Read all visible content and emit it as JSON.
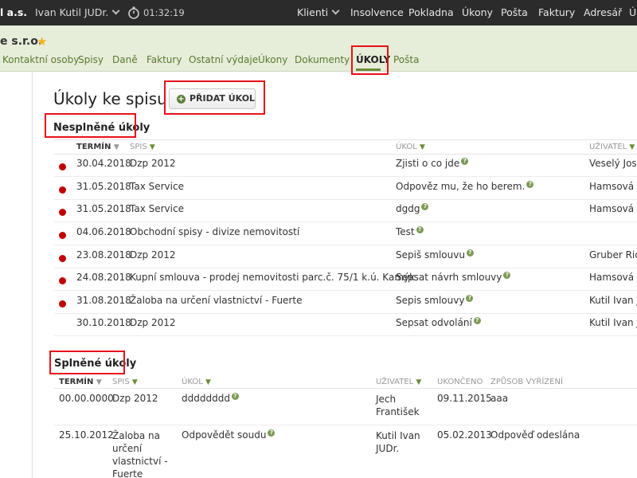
{
  "topbar": {
    "company": "l a.s.",
    "user": "Ivan Kutil JUDr.",
    "timer": "01:32:19",
    "nav": [
      "Klienti",
      "Insolvence",
      "Pokladna",
      "Úkony",
      "Pošta",
      "Faktury",
      "Adresář",
      "Ú"
    ]
  },
  "client": {
    "name": "e s.r.o.",
    "tabs": [
      "Kontaktní osoby",
      "Spisy",
      "Daně",
      "Faktury",
      "Ostatní výdaje",
      "Úkony",
      "Dokumenty",
      "ÚKOLY",
      "Pošta"
    ],
    "active_tab": "ÚKOLY"
  },
  "main": {
    "title": "Úkoly ke spisu",
    "add_button": "PŘIDAT ÚKOL"
  },
  "unfinished": {
    "title": "Nesplněné úkoly",
    "columns": [
      "TERMÍN",
      "SPIS",
      "ÚKOL",
      "UŽIVATEL"
    ],
    "rows": [
      {
        "overdue": true,
        "date": "30.04.2018",
        "file": "Dzp 2012",
        "task": "Zjisti o co jde",
        "user": "Veselý Josef"
      },
      {
        "overdue": true,
        "date": "31.05.2018",
        "file": "Tax Service",
        "task": "Odpověz mu, že ho berem.",
        "user": "Hamsová Te"
      },
      {
        "overdue": true,
        "date": "31.05.2018",
        "file": "Tax Service",
        "task": "dgdg",
        "user": "Hamsová Te"
      },
      {
        "overdue": true,
        "date": "04.06.2018",
        "file": "Obchodní spisy - divize nemovitostí",
        "task": "Test",
        "user": ""
      },
      {
        "overdue": true,
        "date": "23.08.2018",
        "file": "Dzp 2012",
        "task": "Sepiš smlouvu",
        "user": "Gruber Rich"
      },
      {
        "overdue": true,
        "date": "24.08.2018",
        "file": "Kupní smlouva - prodej nemovitosti parc.č. 75/1 k.ú. Kamýk",
        "task": "Sepsat návrh smlouvy",
        "user": "Hamsová Te"
      },
      {
        "overdue": true,
        "date": "31.08.2018",
        "file": "Žaloba na určení vlastnictví - Fuerte",
        "task": "Sepis smlouvy",
        "user": "Kutil Ivan JU"
      },
      {
        "overdue": false,
        "date": "30.10.2018",
        "file": "Dzp 2012",
        "task": "Sepsat odvolání",
        "user": "Kutil Ivan JU"
      }
    ]
  },
  "finished": {
    "title": "Splněné úkoly",
    "columns": [
      "TERMÍN",
      "SPIS",
      "ÚKOL",
      "UŽIVATEL",
      "UKONČENO",
      "ZPŮSOB VYŘÍZENÍ"
    ],
    "rows": [
      {
        "date": "00.00.0000",
        "file": "Dzp 2012",
        "task": "dddddddd",
        "user": "Jech František",
        "done": "09.11.2015",
        "resolution": "aaa"
      },
      {
        "date": "25.10.2012",
        "file": "Žaloba na určení vlastnictví - Fuerte",
        "task": "Odpovědět soudu",
        "user": "Kutil Ivan JUDr.",
        "done": "05.02.2013",
        "resolution": "Odpověď odeslána"
      }
    ]
  },
  "colors": {
    "topbar": "#2b2b2b",
    "subheader": "#e6edd9",
    "accent_green": "#6b8c3a",
    "overdue_dot": "#c00000",
    "highlight": "#e8101a"
  },
  "icons": [
    "chevron-down-icon",
    "stopwatch-icon",
    "star-icon",
    "plus-circle-icon",
    "help-icon",
    "sort-arrow-icon"
  ]
}
